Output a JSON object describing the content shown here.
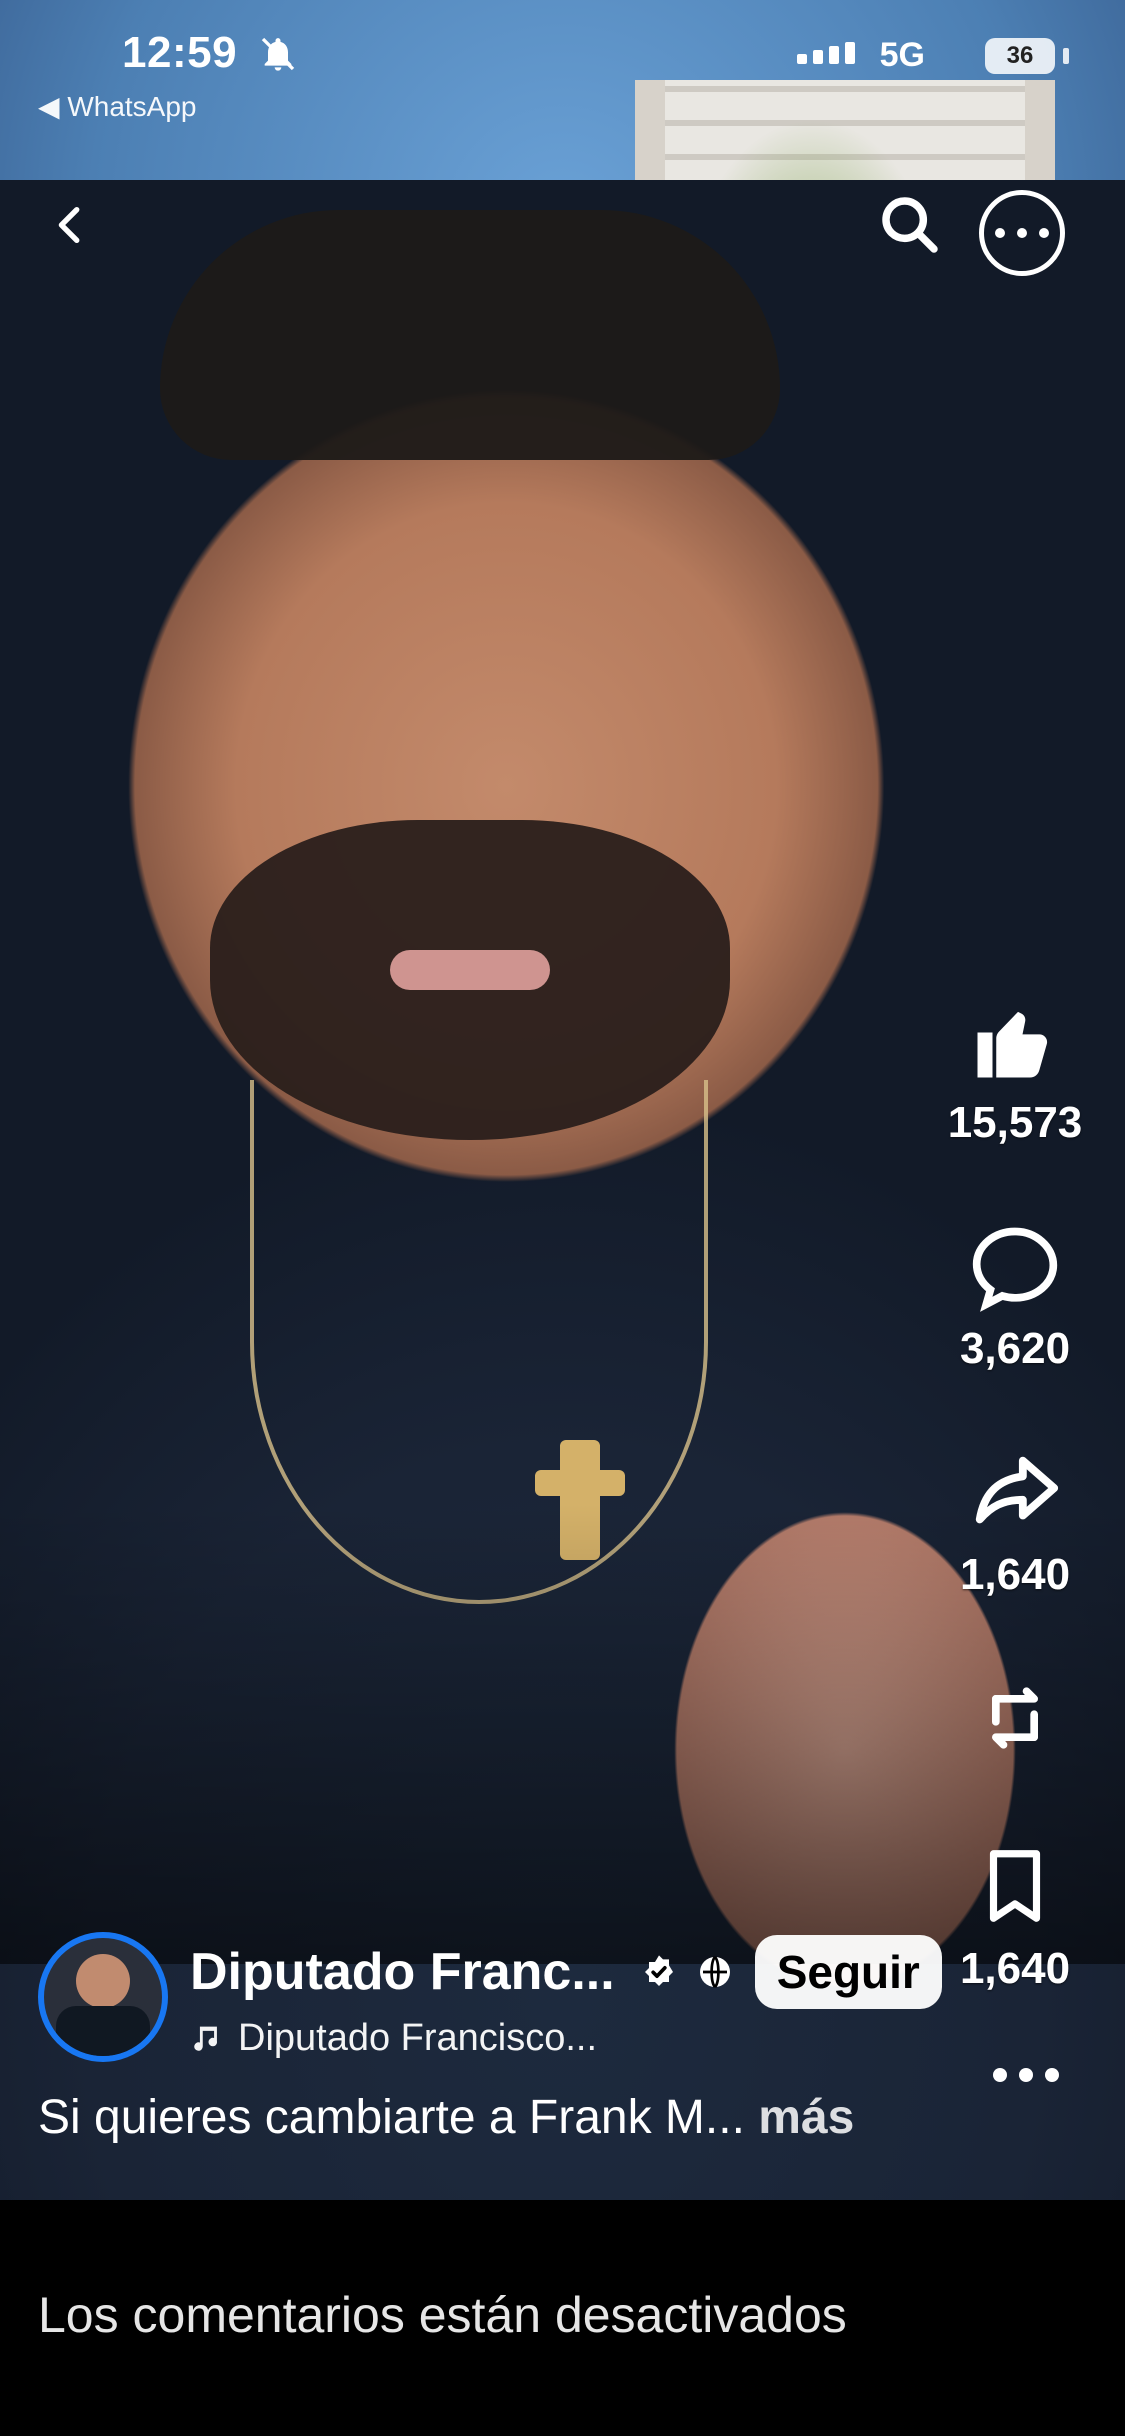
{
  "status_bar": {
    "time": "12:59",
    "back_to_app": "◀ WhatsApp",
    "network": "5G",
    "battery": "36"
  },
  "top_controls": {
    "back_icon": "chevron-left-icon",
    "search_icon": "search-icon",
    "more_icon": "more-horizontal-icon"
  },
  "rail": {
    "likes": "15,573",
    "comments": "3,620",
    "shares": "1,640",
    "saves": "1,640"
  },
  "author": {
    "name": "Diputado Franc...",
    "follow_label": "Seguir",
    "song": "Diputado Francisco..."
  },
  "caption": {
    "text": "Si quieres cambiarte a Frank M...",
    "more_label": "más"
  },
  "bottom": {
    "comments_disabled": "Los comentarios están desactivados"
  },
  "colors": {
    "accent_blue": "#1877f2",
    "follow_bg": "#ffffff",
    "follow_text": "#000000"
  }
}
